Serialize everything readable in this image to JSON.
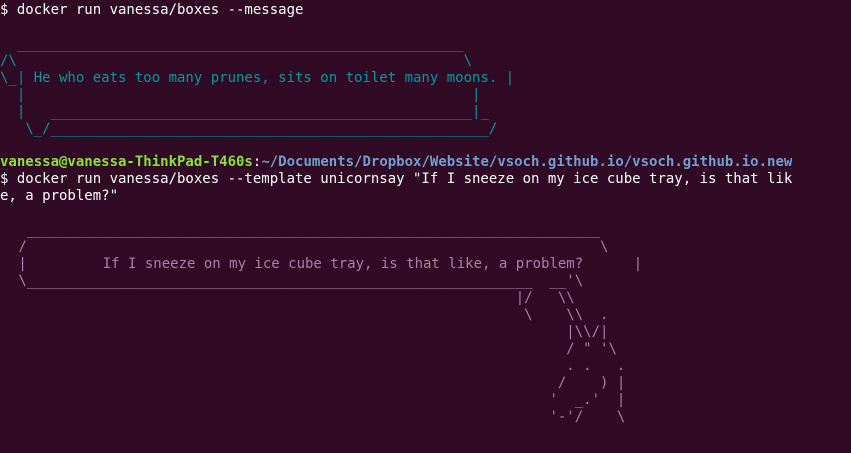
{
  "terminal": {
    "top_cut_text": "                                                 ’  ’  ’               ",
    "command1": "$ docker run vanessa/boxes --message",
    "message_box": {
      "lines": [
        "  _____________________________________________________",
        "/\\                                                     \\",
        "\\_| He who eats too many prunes, sits on toilet many moons. |",
        "  |                                                     |",
        "  |   __________________________________________________|_",
        "   \\_/____________________________________________________/"
      ]
    },
    "prompt": {
      "user_host": "vanessa@vanessa-ThinkPad-T460s",
      "separator": ":",
      "path": "~/Documents/Dropbox/Website/vsoch.github.io/vsoch.github.io.new"
    },
    "command2_line1": "$ docker run vanessa/boxes --template unicornsay \"If I sneeze on my ice cube tray, is that lik",
    "command2_line2": "e, a problem?\"",
    "unicorn_box": {
      "lines": [
        "  ____________________________________________________________________",
        " /                                                                    \\",
        " |         If I sneeze on my ice cube tray, is that like, a problem?      |",
        " \\____________________________________________________________  __'\\",
        "                                                            |/   \\\\",
        "                                                             \\    \\\\  .",
        "                                                                  |\\\\/|",
        "                                                                  / \" '\\",
        "                                                                  . .   .",
        "                                                                 /    ) |",
        "                                                                '  _.'  |",
        "                                                                '-'/    \\"
      ]
    }
  }
}
